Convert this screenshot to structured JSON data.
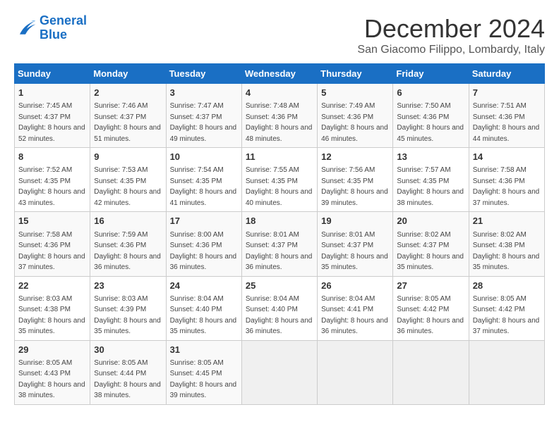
{
  "logo": {
    "line1": "General",
    "line2": "Blue"
  },
  "title": "December 2024",
  "location": "San Giacomo Filippo, Lombardy, Italy",
  "weekdays": [
    "Sunday",
    "Monday",
    "Tuesday",
    "Wednesday",
    "Thursday",
    "Friday",
    "Saturday"
  ],
  "weeks": [
    [
      {
        "day": "1",
        "sunrise": "Sunrise: 7:45 AM",
        "sunset": "Sunset: 4:37 PM",
        "daylight": "Daylight: 8 hours and 52 minutes."
      },
      {
        "day": "2",
        "sunrise": "Sunrise: 7:46 AM",
        "sunset": "Sunset: 4:37 PM",
        "daylight": "Daylight: 8 hours and 51 minutes."
      },
      {
        "day": "3",
        "sunrise": "Sunrise: 7:47 AM",
        "sunset": "Sunset: 4:37 PM",
        "daylight": "Daylight: 8 hours and 49 minutes."
      },
      {
        "day": "4",
        "sunrise": "Sunrise: 7:48 AM",
        "sunset": "Sunset: 4:36 PM",
        "daylight": "Daylight: 8 hours and 48 minutes."
      },
      {
        "day": "5",
        "sunrise": "Sunrise: 7:49 AM",
        "sunset": "Sunset: 4:36 PM",
        "daylight": "Daylight: 8 hours and 46 minutes."
      },
      {
        "day": "6",
        "sunrise": "Sunrise: 7:50 AM",
        "sunset": "Sunset: 4:36 PM",
        "daylight": "Daylight: 8 hours and 45 minutes."
      },
      {
        "day": "7",
        "sunrise": "Sunrise: 7:51 AM",
        "sunset": "Sunset: 4:36 PM",
        "daylight": "Daylight: 8 hours and 44 minutes."
      }
    ],
    [
      {
        "day": "8",
        "sunrise": "Sunrise: 7:52 AM",
        "sunset": "Sunset: 4:35 PM",
        "daylight": "Daylight: 8 hours and 43 minutes."
      },
      {
        "day": "9",
        "sunrise": "Sunrise: 7:53 AM",
        "sunset": "Sunset: 4:35 PM",
        "daylight": "Daylight: 8 hours and 42 minutes."
      },
      {
        "day": "10",
        "sunrise": "Sunrise: 7:54 AM",
        "sunset": "Sunset: 4:35 PM",
        "daylight": "Daylight: 8 hours and 41 minutes."
      },
      {
        "day": "11",
        "sunrise": "Sunrise: 7:55 AM",
        "sunset": "Sunset: 4:35 PM",
        "daylight": "Daylight: 8 hours and 40 minutes."
      },
      {
        "day": "12",
        "sunrise": "Sunrise: 7:56 AM",
        "sunset": "Sunset: 4:35 PM",
        "daylight": "Daylight: 8 hours and 39 minutes."
      },
      {
        "day": "13",
        "sunrise": "Sunrise: 7:57 AM",
        "sunset": "Sunset: 4:35 PM",
        "daylight": "Daylight: 8 hours and 38 minutes."
      },
      {
        "day": "14",
        "sunrise": "Sunrise: 7:58 AM",
        "sunset": "Sunset: 4:36 PM",
        "daylight": "Daylight: 8 hours and 37 minutes."
      }
    ],
    [
      {
        "day": "15",
        "sunrise": "Sunrise: 7:58 AM",
        "sunset": "Sunset: 4:36 PM",
        "daylight": "Daylight: 8 hours and 37 minutes."
      },
      {
        "day": "16",
        "sunrise": "Sunrise: 7:59 AM",
        "sunset": "Sunset: 4:36 PM",
        "daylight": "Daylight: 8 hours and 36 minutes."
      },
      {
        "day": "17",
        "sunrise": "Sunrise: 8:00 AM",
        "sunset": "Sunset: 4:36 PM",
        "daylight": "Daylight: 8 hours and 36 minutes."
      },
      {
        "day": "18",
        "sunrise": "Sunrise: 8:01 AM",
        "sunset": "Sunset: 4:37 PM",
        "daylight": "Daylight: 8 hours and 36 minutes."
      },
      {
        "day": "19",
        "sunrise": "Sunrise: 8:01 AM",
        "sunset": "Sunset: 4:37 PM",
        "daylight": "Daylight: 8 hours and 35 minutes."
      },
      {
        "day": "20",
        "sunrise": "Sunrise: 8:02 AM",
        "sunset": "Sunset: 4:37 PM",
        "daylight": "Daylight: 8 hours and 35 minutes."
      },
      {
        "day": "21",
        "sunrise": "Sunrise: 8:02 AM",
        "sunset": "Sunset: 4:38 PM",
        "daylight": "Daylight: 8 hours and 35 minutes."
      }
    ],
    [
      {
        "day": "22",
        "sunrise": "Sunrise: 8:03 AM",
        "sunset": "Sunset: 4:38 PM",
        "daylight": "Daylight: 8 hours and 35 minutes."
      },
      {
        "day": "23",
        "sunrise": "Sunrise: 8:03 AM",
        "sunset": "Sunset: 4:39 PM",
        "daylight": "Daylight: 8 hours and 35 minutes."
      },
      {
        "day": "24",
        "sunrise": "Sunrise: 8:04 AM",
        "sunset": "Sunset: 4:40 PM",
        "daylight": "Daylight: 8 hours and 35 minutes."
      },
      {
        "day": "25",
        "sunrise": "Sunrise: 8:04 AM",
        "sunset": "Sunset: 4:40 PM",
        "daylight": "Daylight: 8 hours and 36 minutes."
      },
      {
        "day": "26",
        "sunrise": "Sunrise: 8:04 AM",
        "sunset": "Sunset: 4:41 PM",
        "daylight": "Daylight: 8 hours and 36 minutes."
      },
      {
        "day": "27",
        "sunrise": "Sunrise: 8:05 AM",
        "sunset": "Sunset: 4:42 PM",
        "daylight": "Daylight: 8 hours and 36 minutes."
      },
      {
        "day": "28",
        "sunrise": "Sunrise: 8:05 AM",
        "sunset": "Sunset: 4:42 PM",
        "daylight": "Daylight: 8 hours and 37 minutes."
      }
    ],
    [
      {
        "day": "29",
        "sunrise": "Sunrise: 8:05 AM",
        "sunset": "Sunset: 4:43 PM",
        "daylight": "Daylight: 8 hours and 38 minutes."
      },
      {
        "day": "30",
        "sunrise": "Sunrise: 8:05 AM",
        "sunset": "Sunset: 4:44 PM",
        "daylight": "Daylight: 8 hours and 38 minutes."
      },
      {
        "day": "31",
        "sunrise": "Sunrise: 8:05 AM",
        "sunset": "Sunset: 4:45 PM",
        "daylight": "Daylight: 8 hours and 39 minutes."
      },
      null,
      null,
      null,
      null
    ]
  ]
}
